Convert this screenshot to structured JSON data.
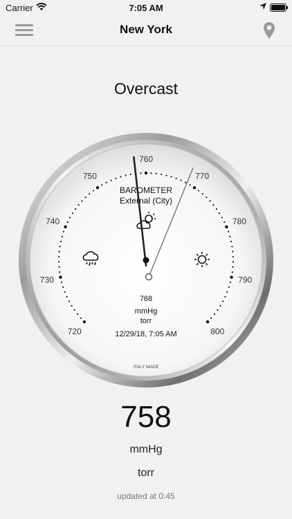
{
  "status_bar": {
    "carrier": "Carrier",
    "time": "7:05 AM"
  },
  "nav": {
    "title": "New York",
    "menu_icon": "hamburger-icon",
    "location_icon": "map-pin-icon"
  },
  "condition": "Overcast",
  "gauge": {
    "scale_labels": [
      "720",
      "730",
      "740",
      "750",
      "760",
      "770",
      "780",
      "790",
      "800"
    ],
    "scale_min": 720,
    "scale_max": 800,
    "title": "BAROMETER",
    "subtitle": "External (City)",
    "reference_value": "768",
    "unit_1": "mmHg",
    "unit_2": "torr",
    "timestamp": "12/29/18, 7:05 AM",
    "maker": "ITALY MADE",
    "current_pointer_value": 758,
    "reference_pointer_value": 768,
    "icons": [
      "rain-cloud-icon",
      "partly-cloudy-icon",
      "sun-icon"
    ]
  },
  "reading": {
    "value": "758",
    "unit_1": "mmHg",
    "unit_2": "torr",
    "updated": "updated at 0:45"
  }
}
